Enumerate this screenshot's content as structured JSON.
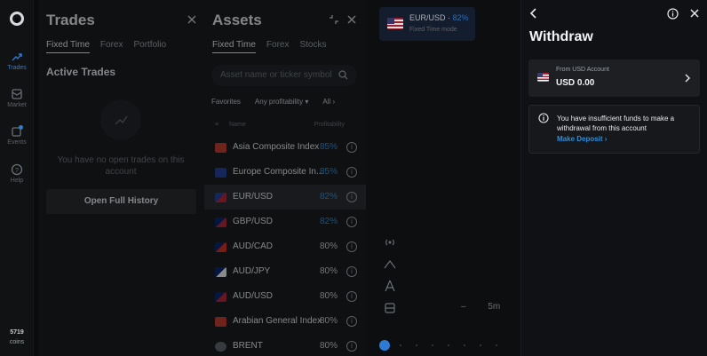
{
  "nav": {
    "items": [
      {
        "label": "Trades",
        "icon": "trades-icon",
        "active": true
      },
      {
        "label": "Market",
        "icon": "market-icon"
      },
      {
        "label": "Events",
        "icon": "events-icon",
        "badge": "1"
      },
      {
        "label": "Help",
        "icon": "help-icon"
      }
    ],
    "balance_value": "5719",
    "balance_unit": "coins"
  },
  "trades_panel": {
    "title": "Trades",
    "tabs": [
      "Fixed Time",
      "Forex",
      "Portfolio"
    ],
    "active_tab": "Fixed Time",
    "section_title": "Active Trades",
    "empty_text": "You have no open trades on this account",
    "history_button": "Open Full History"
  },
  "assets_panel": {
    "title": "Assets",
    "tabs": [
      "Fixed Time",
      "Forex",
      "Stocks"
    ],
    "active_tab": "Fixed Time",
    "search_placeholder": "Asset name or ticker symbol",
    "filters": [
      "Favorites",
      "Any profitability",
      "All"
    ],
    "column_name": "Name",
    "column_profit": "Profitability",
    "assets": [
      {
        "name": "Asia Composite Index",
        "pct": "85%",
        "highlight": true,
        "flag": "asia"
      },
      {
        "name": "Europe Composite In...",
        "pct": "85%",
        "highlight": true,
        "flag": "eu"
      },
      {
        "name": "EUR/USD",
        "pct": "82%",
        "highlight": true,
        "flag": "eurusd",
        "selected": true
      },
      {
        "name": "GBP/USD",
        "pct": "82%",
        "highlight": true,
        "flag": "gbpusd"
      },
      {
        "name": "AUD/CAD",
        "pct": "80%",
        "flag": "audcad"
      },
      {
        "name": "AUD/JPY",
        "pct": "80%",
        "flag": "audjpy"
      },
      {
        "name": "AUD/USD",
        "pct": "80%",
        "flag": "audusd"
      },
      {
        "name": "Arabian General Index",
        "pct": "80%",
        "flag": "arab"
      },
      {
        "name": "BRENT",
        "pct": "80%",
        "flag": "brent"
      }
    ]
  },
  "chart": {
    "pair": "EUR/USD",
    "pair_pct": "82%",
    "mode": "Fixed Time mode",
    "timeframe": "5m",
    "zoom_minus": "–"
  },
  "withdraw": {
    "title": "Withdraw",
    "account_label": "From USD Account",
    "account_value": "USD 0.00",
    "notice_text": "You have insufficient funds to make a withdrawal from this account",
    "notice_link": "Make Deposit"
  },
  "colors": {
    "accent": "#2e7bd6",
    "link": "#2e8ed6",
    "background": "#0a0b0d"
  }
}
